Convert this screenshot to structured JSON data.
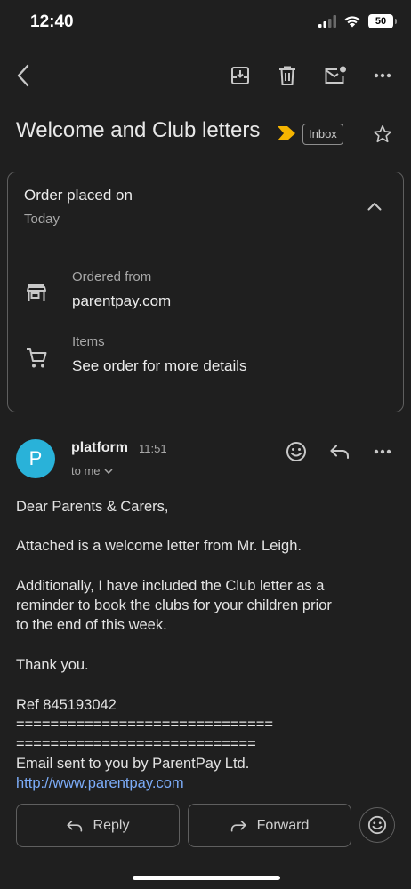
{
  "status_bar": {
    "time": "12:40",
    "battery": "50"
  },
  "email": {
    "subject": "Welcome and Club letters",
    "label": "Inbox",
    "order_card": {
      "title": "Order placed on",
      "date": "Today",
      "ordered_from_label": "Ordered from",
      "ordered_from_value": "parentpay.com",
      "items_label": "Items",
      "items_value": "See order for more details"
    },
    "sender": {
      "initial": "P",
      "name": "platform",
      "time": "11:51",
      "recipient": "to me"
    },
    "body": {
      "greeting": "Dear Parents & Carers,",
      "para1": "Attached is a welcome letter from Mr. Leigh.",
      "para2_line1": "Additionally, I have included the Club letter as a",
      "para2_line2": "reminder to book the clubs for your children prior",
      "para2_line3": "to the end of this week.",
      "thanks": "Thank you.",
      "ref": "Ref 845193042",
      "divider1": "==============================",
      "divider2": "============================",
      "footer": "Email sent to you by ParentPay Ltd.",
      "link": "http://www.parentpay.com"
    }
  },
  "actions": {
    "reply": "Reply",
    "forward": "Forward"
  },
  "colors": {
    "background": "#1f1f1f",
    "avatar": "#29b2d9",
    "important_marker": "#f5b400",
    "link": "#7cacf8"
  },
  "icons": [
    "back-icon",
    "archive-icon",
    "delete-icon",
    "mark-unread-icon",
    "more-icon",
    "important-marker-icon",
    "star-icon",
    "chevron-up-icon",
    "store-icon",
    "cart-icon",
    "emoji-icon",
    "reply-icon",
    "chevron-down-icon",
    "forward-icon"
  ]
}
